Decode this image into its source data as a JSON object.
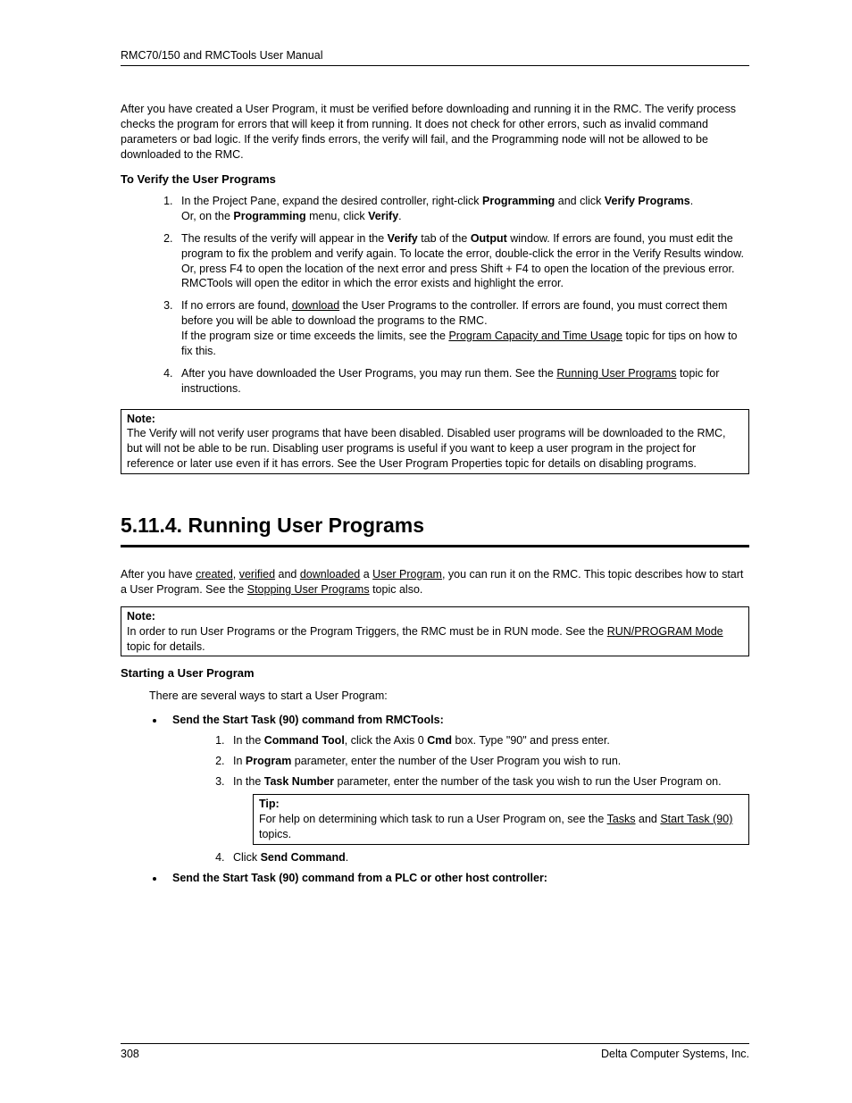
{
  "header": "RMC70/150 and RMCTools User Manual",
  "intro_para": "After you  have created a User Program, it must be verified before downloading and running it in the RMC. The verify process checks the program for errors that will keep it from running. It does not check for other errors, such as invalid command parameters or bad logic. If the verify finds errors, the verify will fail, and the Programming node will not be allowed to be downloaded to the RMC.",
  "verify_heading": "To Verify the User Programs",
  "verify_steps": {
    "s1a": "In the Project Pane, expand the desired controller, right-click ",
    "s1b": "Programming",
    "s1c": " and click ",
    "s1d": "Verify Programs",
    "s1e": ".",
    "s1f": "Or, on the ",
    "s1g": "Programming",
    "s1h": " menu, click ",
    "s1i": "Verify",
    "s1j": ".",
    "s2a": "The results of the verify will appear in the ",
    "s2b": "Verify",
    "s2c": " tab of the ",
    "s2d": "Output",
    "s2e": " window. If errors are found, you must edit the program to fix the problem and verify again. To locate the error, double-click the error in the Verify Results window. Or, press F4 to open the location of the next error and press Shift + F4 to open the location of the previous error. RMCTools will open the editor in which the error exists and highlight the error.",
    "s3a": "If no errors are found, ",
    "s3b": "download",
    "s3c": " the User Programs to the controller. If errors are found, you must correct them before you will be able to download the programs to the RMC.",
    "s3d": "If the program size or time exceeds the limits, see the ",
    "s3e": "Program Capacity and Time Usage",
    "s3f": " topic for tips on how to fix this.",
    "s4a": "After you have downloaded the User Programs, you may run them. See the ",
    "s4b": "Running User Programs",
    "s4c": " topic for instructions."
  },
  "note1": {
    "label": "Note:",
    "text": "The Verify will not verify user programs that have been disabled. Disabled user programs will be downloaded to the RMC, but will not be able to be run. Disabling user programs is useful if you want to keep a user program in the project for reference or later use even if it has errors. See the User Program Properties topic for details on disabling programs."
  },
  "section_title": "5.11.4. Running User Programs",
  "run_intro": {
    "a": "After you have ",
    "b": "created",
    "c": ", ",
    "d": "verified",
    "e": " and ",
    "f": "downloaded",
    "g": " a ",
    "h": "User Program",
    "i": ", you can run it on the RMC. This topic describes how to start a User Program. See the ",
    "j": "Stopping User Programs",
    "k": " topic also."
  },
  "note2": {
    "label": "Note:",
    "a": "In order to run User Programs or the Program Triggers, the RMC must be in RUN mode. See the ",
    "b": "RUN/PROGRAM Mode",
    "c": " topic for details."
  },
  "start_heading": "Starting a User Program",
  "start_intro": "There are several ways to start a User Program:",
  "bullet1": "Send the Start Task (90) command from RMCTools:",
  "inner": {
    "i1a": "In the ",
    "i1b": "Command Tool",
    "i1c": ", click the Axis 0 ",
    "i1d": "Cmd",
    "i1e": " box. Type \"90\" and press enter.",
    "i2a": "In ",
    "i2b": "Program",
    "i2c": " parameter, enter the number of the User Program you wish to run.",
    "i3a": "In the ",
    "i3b": "Task Number",
    "i3c": " parameter, enter the number of the task you wish to run the User Program on.",
    "i4a": "Click ",
    "i4b": "Send Command",
    "i4c": "."
  },
  "tip": {
    "label": "Tip:",
    "a": "For help on determining which task to run a User Program on, see the ",
    "b": "Tasks",
    "c": " and ",
    "d": "Start Task (90)",
    "e": " topics."
  },
  "bullet2": "Send the Start Task (90) command from a PLC or other host controller:",
  "footer": {
    "page": "308",
    "company": "Delta Computer Systems, Inc."
  }
}
